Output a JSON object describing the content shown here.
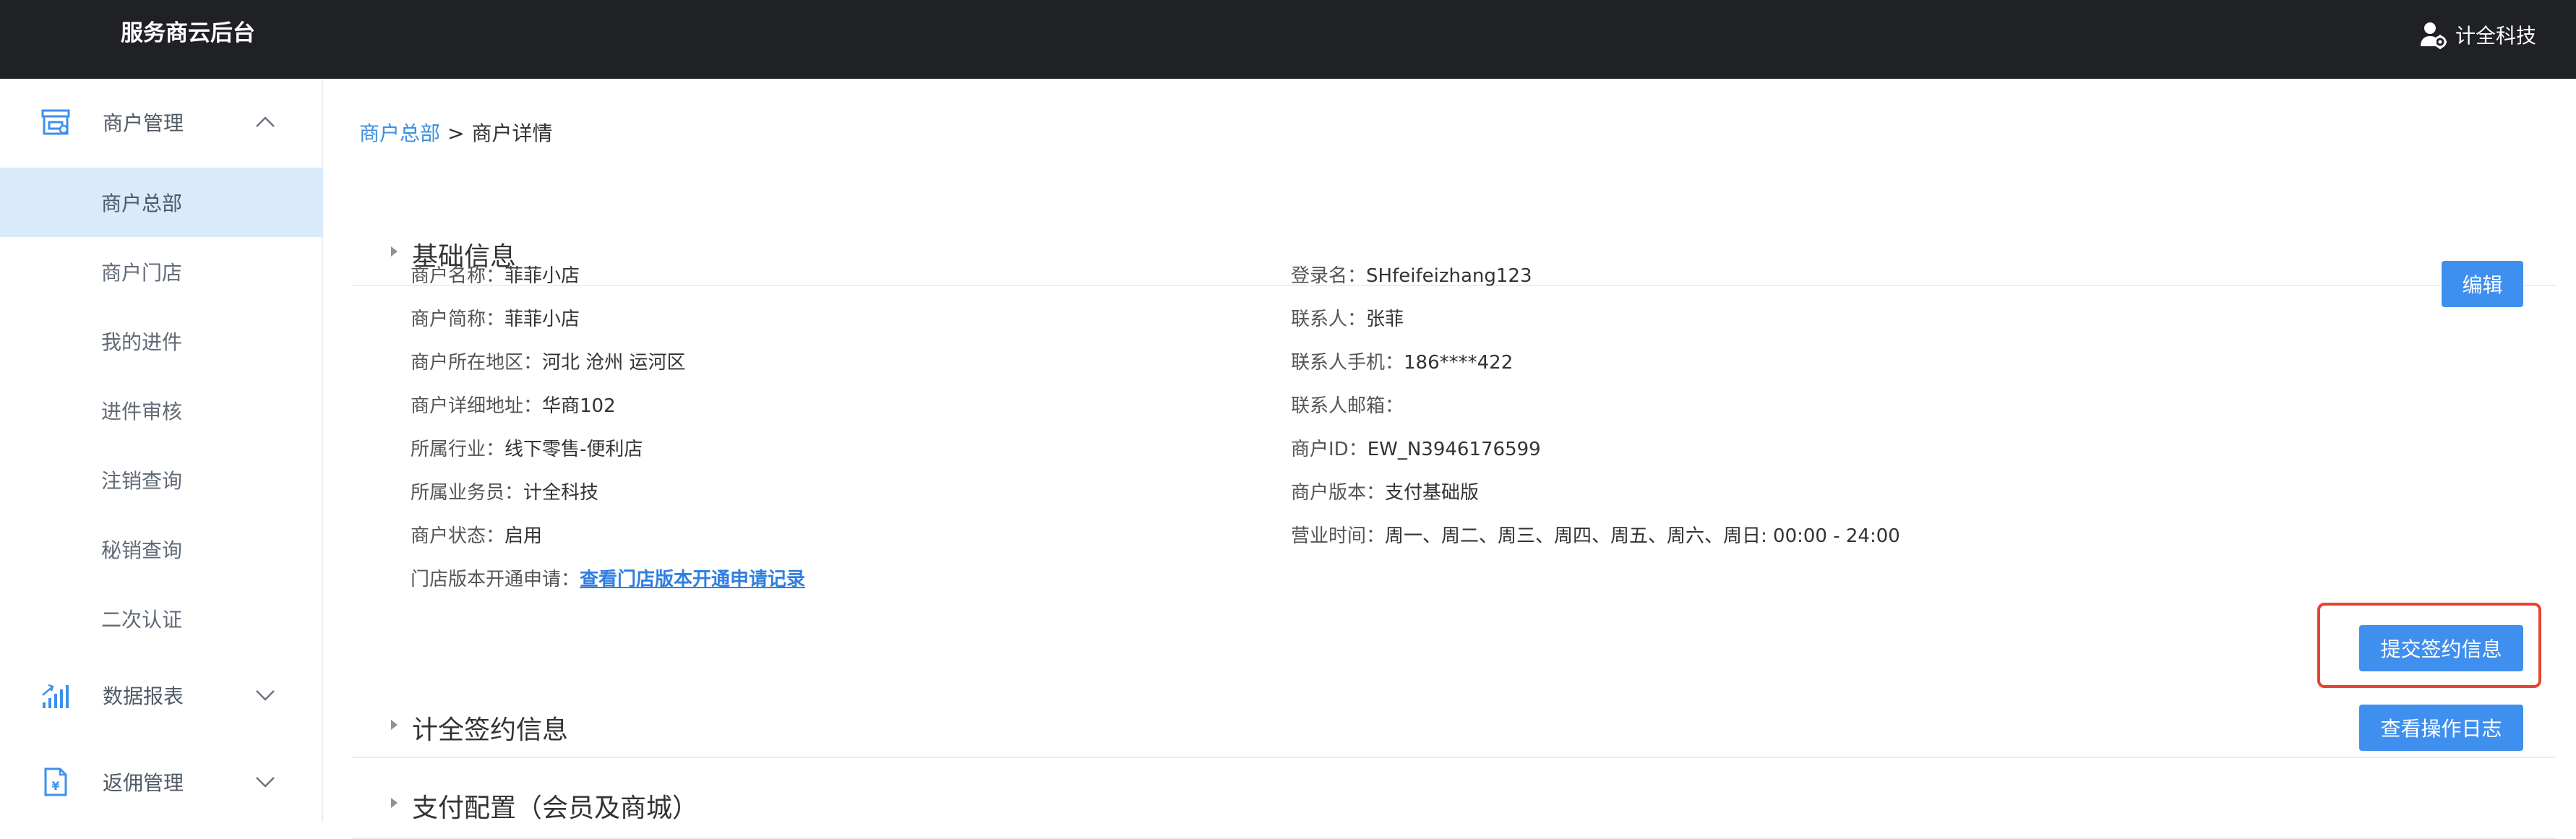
{
  "header": {
    "app_title": "服务商云后台",
    "user_name": "计全科技"
  },
  "sidebar": {
    "groups": [
      {
        "label": "商户管理",
        "icon": "store-icon",
        "expanded": true
      },
      {
        "label": "数据报表",
        "icon": "chart-bars-icon",
        "expanded": false
      },
      {
        "label": "返佣管理",
        "icon": "document-icon",
        "expanded": false
      }
    ],
    "items": [
      "商户总部",
      "商户门店",
      "我的进件",
      "进件审核",
      "注销查询",
      "秘销查询",
      "二次认证"
    ],
    "active_item": "商户总部"
  },
  "breadcrumb": {
    "parent": "商户总部",
    "separator": ">",
    "current": "商户详情"
  },
  "sections": {
    "basic": {
      "title": "基础信息",
      "action": "编辑"
    },
    "sign": {
      "title": "计全签约信息",
      "action": "提交签约信息"
    },
    "pay": {
      "title": "支付配置（会员及商城）",
      "action": "查看操作日志"
    }
  },
  "info_left": [
    {
      "label": "商户名称：",
      "value": "菲菲小店"
    },
    {
      "label": "商户简称：",
      "value": "菲菲小店"
    },
    {
      "label": "商户所在地区：",
      "value": "河北 沧州 运河区"
    },
    {
      "label": "商户详细地址：",
      "value": "华商102"
    },
    {
      "label": "所属行业：",
      "value": "线下零售-便利店"
    },
    {
      "label": "所属业务员：",
      "value": "计全科技"
    },
    {
      "label": "商户状态：",
      "value": "启用"
    },
    {
      "label": "门店版本开通申请：",
      "value": "查看门店版本开通申请记录"
    }
  ],
  "info_right": [
    {
      "label": "登录名：",
      "value": "SHfeifeizhang123"
    },
    {
      "label": "联系人：",
      "value": "张菲"
    },
    {
      "label": "联系人手机：",
      "value": "186****422"
    },
    {
      "label": "联系人邮箱：",
      "value": ""
    },
    {
      "label": "商户ID：",
      "value": "EW_N3946176599"
    },
    {
      "label": "商户版本：",
      "value": "支付基础版"
    },
    {
      "label": "营业时间：",
      "value": "周一、周二、周三、周四、周五、周六、周日: 00:00 - 24:00"
    }
  ],
  "colors": {
    "topbar": "#1f2124",
    "accent": "#3f8fee",
    "link": "#3d8fe0",
    "active_bg": "#d9eafa",
    "highlight": "#e8432f"
  }
}
